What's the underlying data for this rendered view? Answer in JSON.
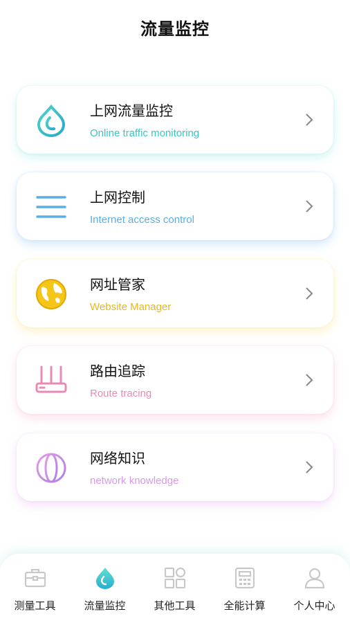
{
  "header": {
    "title": "流量监控"
  },
  "menu": [
    {
      "title": "上网流量监控",
      "subtitle": "Online traffic monitoring",
      "icon": "water-drop-icon",
      "color": "#3cc4c4"
    },
    {
      "title": "上网控制",
      "subtitle": "Internet access control",
      "icon": "menu-lines-icon",
      "color": "#5aaee6"
    },
    {
      "title": "网址管家",
      "subtitle": "Website Manager",
      "icon": "globe-icon",
      "color": "#f0c420"
    },
    {
      "title": "路由追踪",
      "subtitle": "Route tracing",
      "icon": "router-icon",
      "color": "#e98ab4"
    },
    {
      "title": "网络知识",
      "subtitle": "network knowledge",
      "icon": "network-globe-icon",
      "color": "#d69ae6"
    }
  ],
  "tabs": [
    {
      "label": "测量工具",
      "icon": "toolbox-icon"
    },
    {
      "label": "流量监控",
      "icon": "water-drop-icon",
      "active": true
    },
    {
      "label": "其他工具",
      "icon": "apps-grid-icon"
    },
    {
      "label": "全能计算",
      "icon": "calculator-icon"
    },
    {
      "label": "个人中心",
      "icon": "user-icon"
    }
  ],
  "colors": {
    "accent": "#3cc4c4",
    "inactive_icon": "#c8c8c8"
  }
}
